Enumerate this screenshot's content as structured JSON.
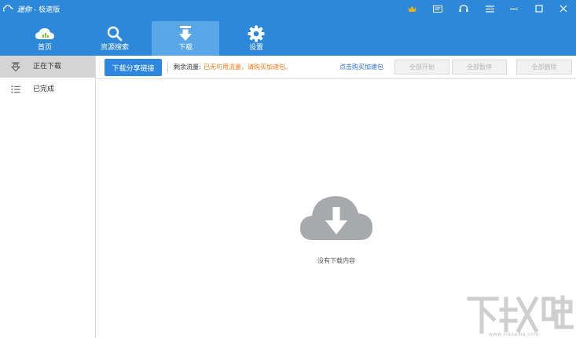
{
  "app": {
    "brand": "迷你",
    "title": "- 极速版"
  },
  "nav": {
    "items": [
      {
        "label": "首页",
        "icon": "cloud-home-icon"
      },
      {
        "label": "资源搜索",
        "icon": "search-icon"
      },
      {
        "label": "下载",
        "icon": "download-arrow-icon",
        "active": true
      },
      {
        "label": "设置",
        "icon": "gear-icon"
      }
    ]
  },
  "sidebar": {
    "items": [
      {
        "label": "正在下载",
        "icon": "downloading-icon",
        "active": true
      },
      {
        "label": "已完成",
        "icon": "list-icon"
      }
    ]
  },
  "toolbar": {
    "share_button": "下载分享链接",
    "traffic_label": "剩余流量:",
    "traffic_warning": "已无可用流量，请购买加速包。",
    "buy_link": "点击购买加速包",
    "start_all": "全部开始",
    "pause_all": "全部暂停",
    "delete_all": "全部删除"
  },
  "empty_state": {
    "text": "没有下载内容",
    "icon": "cloud-download-icon"
  },
  "watermark": {
    "text": "下载吧",
    "url": "www.xiazaiba.com"
  },
  "colors": {
    "header": "#2d88d9",
    "active_nav": "#5aa7e8",
    "primary_button": "#2f88e0",
    "warning": "#f07a1a",
    "link": "#2a6fc9"
  }
}
